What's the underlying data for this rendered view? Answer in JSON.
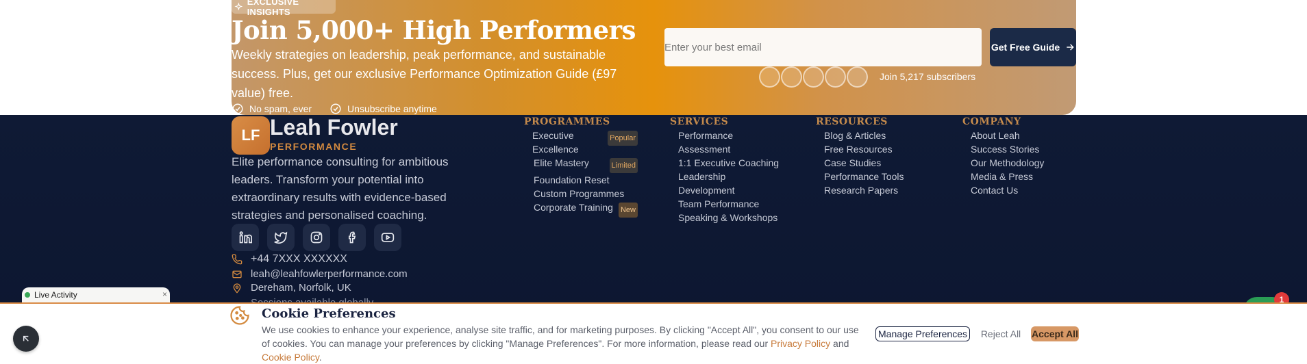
{
  "newsletter": {
    "badge": "EXCLUSIVE INSIGHTS",
    "title": "Join 5,000+ High Performers",
    "description": "Weekly strategies on leadership, peak performance, and sustainable success. Plus, get our exclusive Performance Optimization Guide (£97 value) free.",
    "bullets": [
      "No spam, ever",
      "Unsubscribe anytime"
    ],
    "email_placeholder": "Enter your best email",
    "cta_label": "Get Free Guide",
    "subscribers_text": "Join 5,217 subscribers"
  },
  "brand": {
    "initials": "LF",
    "name": "Leah Fowler",
    "subtitle": "PERFORMANCE",
    "description": "Elite performance consulting for ambitious leaders. Transform your potential into extraordinary results with evidence-based strategies and personalised coaching."
  },
  "socials": [
    "linkedin-icon",
    "twitter-icon",
    "instagram-icon",
    "facebook-icon",
    "youtube-icon"
  ],
  "contact": {
    "phone": "+44 7XXX XXXXXX",
    "email": "leah@leahfowlerperformance.com",
    "location": "Dereham, Norfolk, UK",
    "sessions": "Sessions available globally"
  },
  "columns": {
    "programmes": {
      "heading": "PROGRAMMES",
      "items": [
        {
          "label": "Executive Excellence",
          "tag": "Popular"
        },
        {
          "label": "Elite Mastery",
          "tag": "Limited"
        },
        {
          "label": "Foundation Reset",
          "tag": ""
        },
        {
          "label": "Custom Programmes",
          "tag": ""
        },
        {
          "label": "Corporate Training",
          "tag": "New"
        }
      ]
    },
    "services": {
      "heading": "SERVICES",
      "items": [
        "Performance Assessment",
        "1:1 Executive Coaching",
        "Leadership Development",
        "Team Performance",
        "Speaking & Workshops"
      ]
    },
    "resources": {
      "heading": "RESOURCES",
      "items": [
        "Blog & Articles",
        "Free Resources",
        "Case Studies",
        "Performance Tools",
        "Research Papers"
      ]
    },
    "company": {
      "heading": "COMPANY",
      "items": [
        "About Leah",
        "Success Stories",
        "Our Methodology",
        "Media & Press",
        "Contact Us"
      ]
    }
  },
  "live_activity": {
    "label": "Live Activity",
    "close": "×"
  },
  "chat": {
    "badge_count": "1"
  },
  "cookie": {
    "title": "Cookie Preferences",
    "text_before": "We use cookies to enhance your experience, analyse site traffic, and for marketing purposes. By clicking \"Accept All\", you consent to our use of cookies. You can manage your preferences by clicking \"Manage Preferences\". For more information, please read our ",
    "privacy_link": "Privacy Policy",
    "and": " and ",
    "cookie_link": "Cookie Policy",
    "end": ".",
    "manage_label": "Manage Preferences",
    "reject_label": "Reject All",
    "accept_label": "Accept All"
  },
  "colors": {
    "accent": "#d38a3f",
    "navy": "#0f1a35",
    "cta": "#1b2a47"
  }
}
